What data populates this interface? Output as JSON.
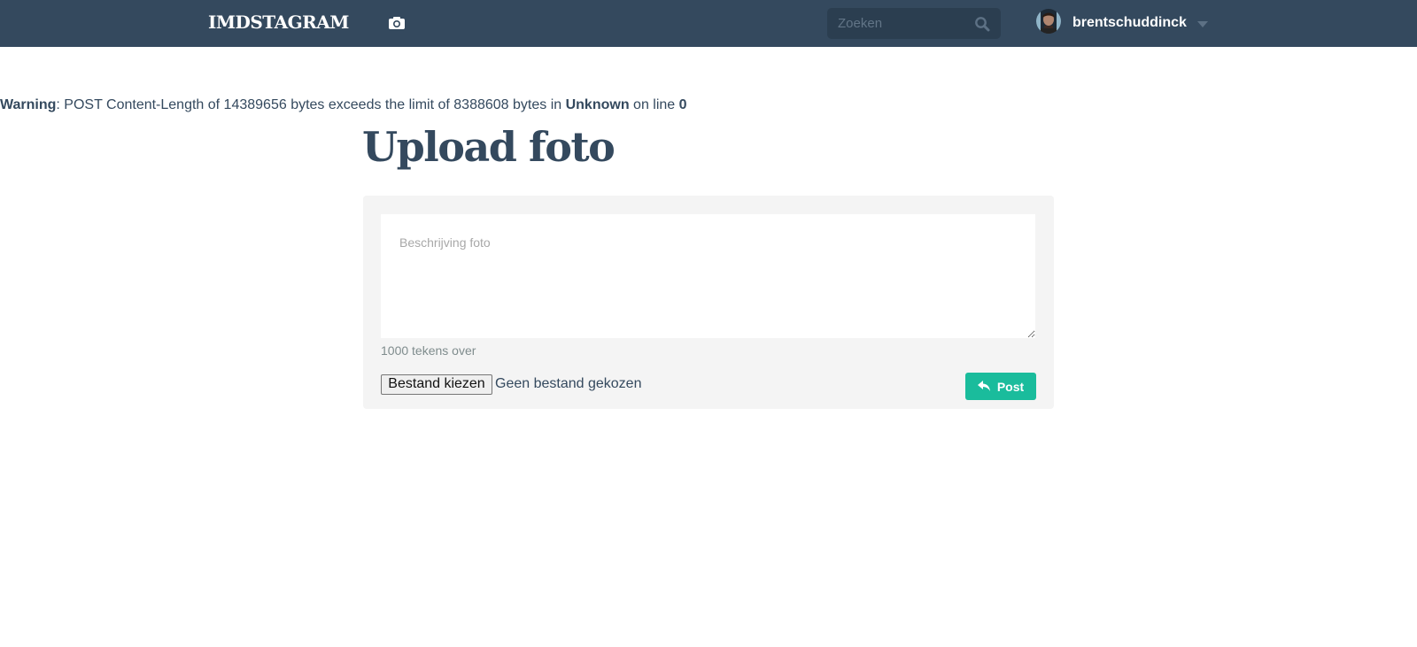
{
  "navbar": {
    "brand": "IMDSTAGRAM",
    "camera_icon": "camera-icon",
    "search": {
      "placeholder": "Zoeken",
      "icon": "search-icon"
    },
    "user": {
      "username": "brentschuddinck",
      "avatar_icon": "avatar",
      "dropdown_icon": "caret-down-icon"
    }
  },
  "warning": {
    "label": "Warning",
    "message": ": POST Content-Length of 14389656 bytes exceeds the limit of 8388608 bytes in ",
    "file": "Unknown",
    "line_text": " on line ",
    "line": "0"
  },
  "page": {
    "title": "Upload foto"
  },
  "form": {
    "description_placeholder": "Beschrijving foto",
    "description_value": "",
    "char_count": "1000 tekens over",
    "file_button_label": "Bestand kiezen",
    "file_status": "Geen bestand gekozen",
    "post_button_label": "Post",
    "post_icon": "reply-icon"
  },
  "colors": {
    "navbar": "#34495e",
    "search_bg": "#2b3e50",
    "panel": "#f4f4f4",
    "accent": "#1abc9c",
    "text": "#34495e"
  }
}
